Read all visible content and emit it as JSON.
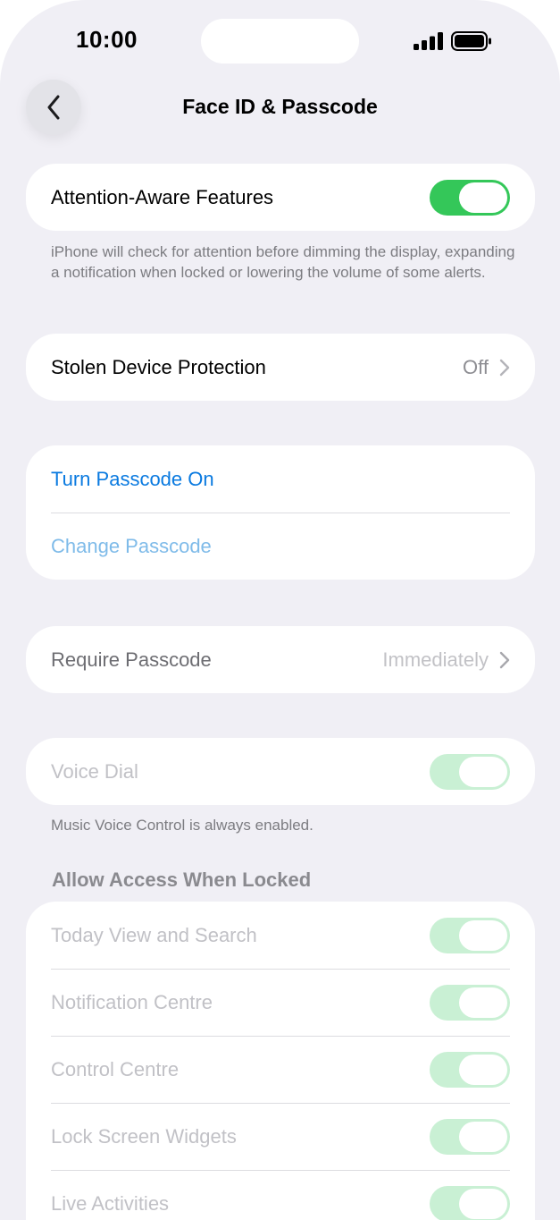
{
  "status": {
    "time": "10:00"
  },
  "nav": {
    "title": "Face ID & Passcode",
    "back_icon": "chevron-left-icon"
  },
  "attention": {
    "label": "Attention-Aware Features",
    "enabled": true,
    "footnote": "iPhone will check for attention before dimming the display, expanding a notification when locked or lowering the volume of some alerts."
  },
  "stolen_device": {
    "label": "Stolen Device Protection",
    "value": "Off"
  },
  "passcode": {
    "turn_on_label": "Turn Passcode On",
    "change_label": "Change Passcode"
  },
  "require_passcode": {
    "label": "Require Passcode",
    "value": "Immediately"
  },
  "voice_dial": {
    "label": "Voice Dial",
    "enabled": true,
    "footnote": "Music Voice Control is always enabled."
  },
  "locked_access": {
    "header": "Allow Access When Locked",
    "items": [
      {
        "label": "Today View and Search",
        "enabled": true
      },
      {
        "label": "Notification Centre",
        "enabled": true
      },
      {
        "label": "Control Centre",
        "enabled": true
      },
      {
        "label": "Lock Screen Widgets",
        "enabled": true
      },
      {
        "label": "Live Activities",
        "enabled": true
      }
    ]
  },
  "colors": {
    "accent_blue": "#0a7ae0",
    "toggle_on": "#34c759",
    "background": "#f0eff5"
  }
}
